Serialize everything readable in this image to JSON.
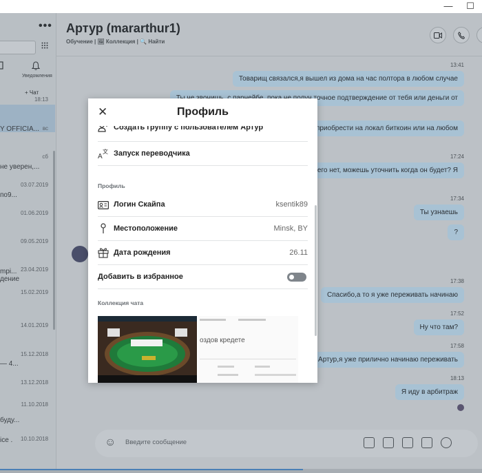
{
  "window": {
    "minimize_glyph": "—",
    "maximize_glyph": "☐"
  },
  "sidebar": {
    "more_glyph": "•••",
    "notifications_label": "Уведомления",
    "new_chat_label": "+ Чат",
    "rows": [
      {
        "date": "18:13",
        "text": ""
      },
      {
        "date": "вс",
        "text": "Y OFFICIA..."
      },
      {
        "date": "сб",
        "text": "не уверен,..."
      },
      {
        "date": "03.07.2019",
        "text": "по9..."
      },
      {
        "date": "01.06.2019",
        "text": ""
      },
      {
        "date": "09.05.2019",
        "text": "mpi..."
      },
      {
        "date": "23.04.2019",
        "text": "дение"
      },
      {
        "date": "15.02.2019",
        "text": ""
      },
      {
        "date": "14.01.2019",
        "text": ""
      },
      {
        "date": "15.12.2018",
        "text": "— 4..."
      },
      {
        "date": "13.12.2018",
        "text": ""
      },
      {
        "date": "11.10.2018",
        "text": "буду..."
      },
      {
        "date": "10.10.2018",
        "text": "ice ."
      },
      {
        "date": "",
        "text": "— 4..."
      }
    ]
  },
  "chat": {
    "title": "Артур (mararthur1)",
    "subtitle": "Обучение | 🖼 Коллекция | 🔍 Найти",
    "timestamps": [
      "13:41",
      "17:24",
      "17:34",
      "17:38",
      "17:52",
      "17:58",
      "18:13"
    ],
    "messages": [
      "Товарищ связался,я вышел из дома на час полтора в любом случае",
      "Ты че звонишь, с парнейбе, пока не получ точное подтверждение от тебя или деньги от",
      "приобрести на локал биткоин или на любом",
      ", его нет, можешь уточнить когда он будет? Я",
      "Ты узнаешь",
      "?",
      "Спасибо,а то я уже переживать начинаю",
      "Ну что там?",
      "Артур,я уже прилично начинаю переживать",
      "Я иду в арбитраж"
    ],
    "composer_placeholder": "Введите сообщение"
  },
  "modal": {
    "title": "Профиль",
    "close_glyph": "✕",
    "actions": [
      {
        "label": "Создать группу с пользователем Артур",
        "icon": "group-add-icon"
      },
      {
        "label": "Запуск переводчика",
        "icon": "translate-icon"
      }
    ],
    "profile_section_label": "Профиль",
    "profile_rows": [
      {
        "label": "Логин Скайпа",
        "value": "ksentik89",
        "icon": "id-card-icon"
      },
      {
        "label": "Местоположение",
        "value": "Minsk, BY",
        "icon": "location-pin-icon"
      },
      {
        "label": "Дата рождения",
        "value": "26.11",
        "icon": "gift-icon"
      }
    ],
    "favorites_label": "Добавить в избранное",
    "favorites_on": false,
    "collection_section_label": "Коллекция чата",
    "thumb2_heading": "оздов кредете"
  }
}
